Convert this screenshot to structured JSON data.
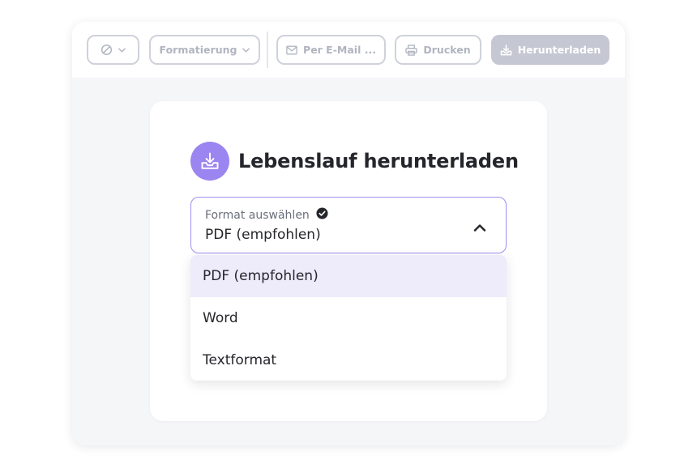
{
  "toolbar": {
    "style_button": {
      "icon": "slash-circle-icon",
      "chevron": "chevron-down-icon"
    },
    "formatting": {
      "label": "Formatierung",
      "chevron": "chevron-down-icon"
    },
    "email": {
      "label": "Per E-Mail ...",
      "icon": "mail-icon"
    },
    "print": {
      "label": "Drucken",
      "icon": "printer-icon"
    },
    "download": {
      "label": "Herunterladen",
      "icon": "download-tray-icon"
    }
  },
  "dialog": {
    "title": "Lebenslauf herunterladen",
    "icon": "download-tray-icon",
    "format_select": {
      "label": "Format auswählen",
      "value": "PDF (empfohlen)",
      "expanded": true,
      "options": [
        "PDF (empfohlen)",
        "Word",
        "Textformat"
      ],
      "selected_index": 0
    }
  },
  "colors": {
    "accent": "#9b85f0",
    "accent_border": "#a28ef2",
    "selected_option_bg": "#eeebfb",
    "disabled_text": "#b1b5c0",
    "primary_disabled_bg": "#c5c8d2"
  }
}
